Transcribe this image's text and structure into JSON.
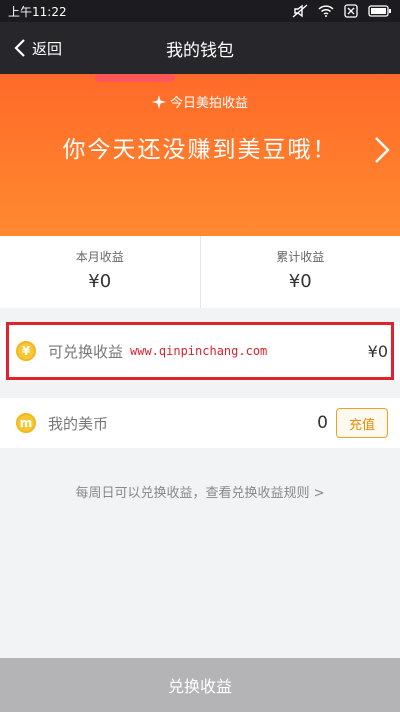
{
  "status_bar": {
    "time": "上午11:22"
  },
  "nav": {
    "back_label": "返回",
    "title": "我的钱包"
  },
  "banner": {
    "subtitle": "今日美拍收益",
    "headline": "你今天还没赚到美豆哦！"
  },
  "stats": {
    "month_label": "本月收益",
    "month_value": "¥0",
    "total_label": "累计收益",
    "total_value": "¥0"
  },
  "exchange_row": {
    "icon_text": "¥",
    "label": "可兑换收益",
    "value": "¥0"
  },
  "watermark": "www.qinpinchang.com",
  "beans_row": {
    "icon_text": "m",
    "label": "我的美币",
    "value": "0",
    "recharge_label": "充值"
  },
  "hint": "每周日可以兑换收益，查看兑换收益规则 >",
  "bottom_button": "兑换收益",
  "colors": {
    "accent": "#ff7a2c",
    "highlight": "#e0222b",
    "coin": "#f6c934"
  }
}
